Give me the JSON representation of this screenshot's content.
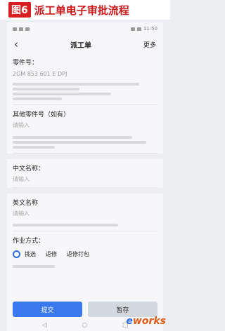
{
  "figure": {
    "badge": "图6",
    "title": "派工单电子审批流程"
  },
  "statusbar": {
    "time": "11:50"
  },
  "navbar": {
    "back_icon": "‹",
    "title": "派工单",
    "more": "更多"
  },
  "part_number": {
    "label": "零件号：",
    "value": "2GM 853 601 E DPJ"
  },
  "other_part": {
    "label": "其他零件号（如有）",
    "placeholder": "请输入"
  },
  "cn_name": {
    "label": "中文名称：",
    "placeholder": "请输入"
  },
  "en_name": {
    "label": "英文名称",
    "placeholder": "请输入"
  },
  "work_mode": {
    "label": "作业方式：",
    "options": [
      "挑选",
      "返修",
      "返修打包"
    ],
    "selected": "挑选"
  },
  "buttons": {
    "submit": "提交",
    "save": "暂存"
  },
  "sysnav": {
    "back": "◁",
    "home": "○",
    "recent": "□"
  },
  "watermark": {
    "prefix": "e",
    "suffix": "works"
  }
}
